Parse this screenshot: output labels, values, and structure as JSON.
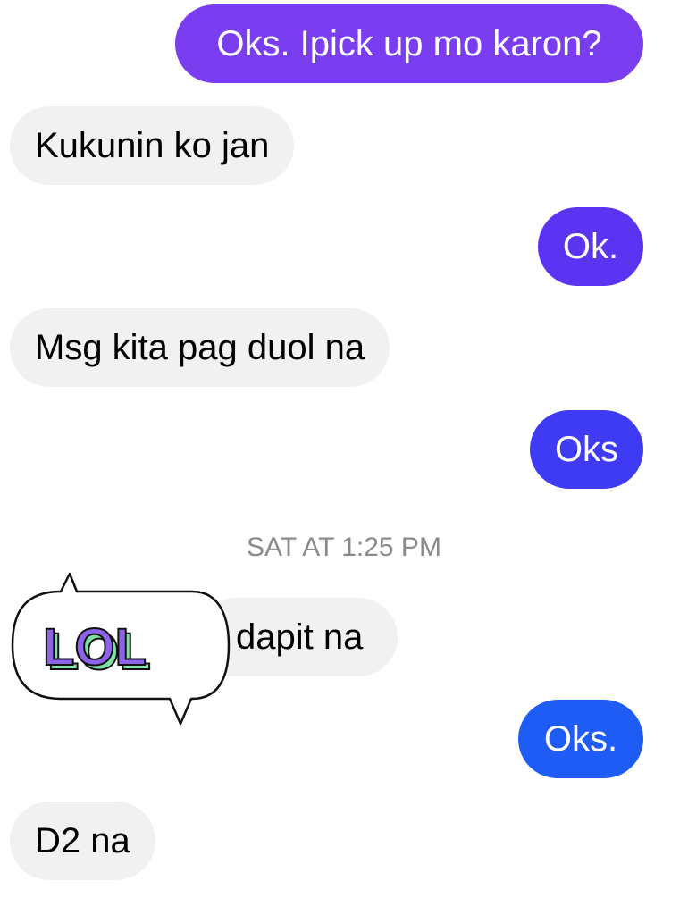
{
  "messages": [
    {
      "text": "Oks. Ipick up mo karon?",
      "from": "me",
      "color": "#7a3df0"
    },
    {
      "text": "Kukunin ko jan",
      "from": "them"
    },
    {
      "text": "Ok.",
      "from": "me",
      "color": "#5a34f2"
    },
    {
      "text": "Msg kita pag duol na",
      "from": "them"
    },
    {
      "text": "Oks",
      "from": "me",
      "color": "#3f3bf4"
    },
    {
      "text": "dapit na",
      "from": "them"
    },
    {
      "text": "Oks.",
      "from": "me",
      "color": "#1f5cf6"
    },
    {
      "text": "D2 na",
      "from": "them"
    }
  ],
  "timestamp": "SAT AT 1:25 PM",
  "sticker": {
    "text": "LOL",
    "icon": "lol-sticker-icon",
    "fill": "#8d63e8",
    "shade": "#7fe0a8"
  },
  "colors": {
    "received_bubble": "#f1f1f1",
    "timestamp": "#8a8a8a"
  }
}
